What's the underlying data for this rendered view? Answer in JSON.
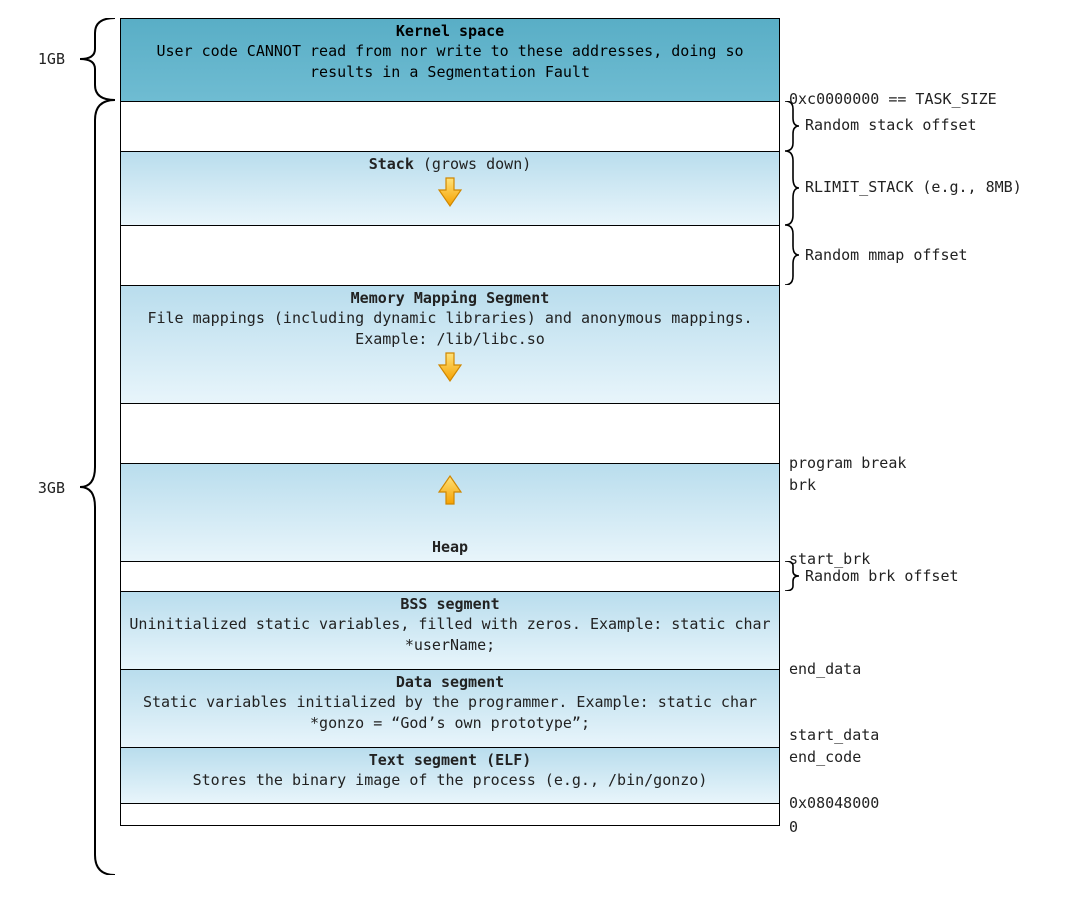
{
  "left": {
    "kernel_size": "1GB",
    "user_size": "3GB"
  },
  "segments": {
    "kernel": {
      "title": "Kernel space",
      "sub": "User code CANNOT read from nor write to these addresses, doing so results in a Segmentation Fault"
    },
    "gap_stack_offset": "",
    "stack": {
      "title": "Stack",
      "note": " (grows down)"
    },
    "gap_mmap_offset": "",
    "mmap": {
      "title": "Memory Mapping Segment",
      "sub": "File mappings (including dynamic libraries) and anonymous mappings. Example: /lib/libc.so"
    },
    "gap_heap_above": "",
    "heap": {
      "title": "Heap"
    },
    "gap_brk_offset": "",
    "bss": {
      "title": "BSS segment",
      "sub": "Uninitialized static variables, filled with zeros. Example: static char *userName;"
    },
    "data": {
      "title": "Data segment",
      "sub": "Static variables initialized by the programmer. Example: static char *gonzo = “God’s own prototype”;"
    },
    "text": {
      "title": "Text segment (ELF)",
      "sub": "Stores the binary image of the process (e.g., /bin/gonzo)"
    },
    "gap_bottom": ""
  },
  "right": {
    "task_size": "0xc0000000 == TASK_SIZE",
    "rand_stack": "Random stack offset",
    "rlimit_stack": "RLIMIT_STACK (e.g., 8MB)",
    "rand_mmap": "Random mmap offset",
    "program_break": "program break",
    "brk": "brk",
    "start_brk": "start_brk",
    "rand_brk": "Random brk offset",
    "end_data": "end_data",
    "start_data": "start_data",
    "end_code": "end_code",
    "text_addr": "0x08048000",
    "zero": "0"
  }
}
